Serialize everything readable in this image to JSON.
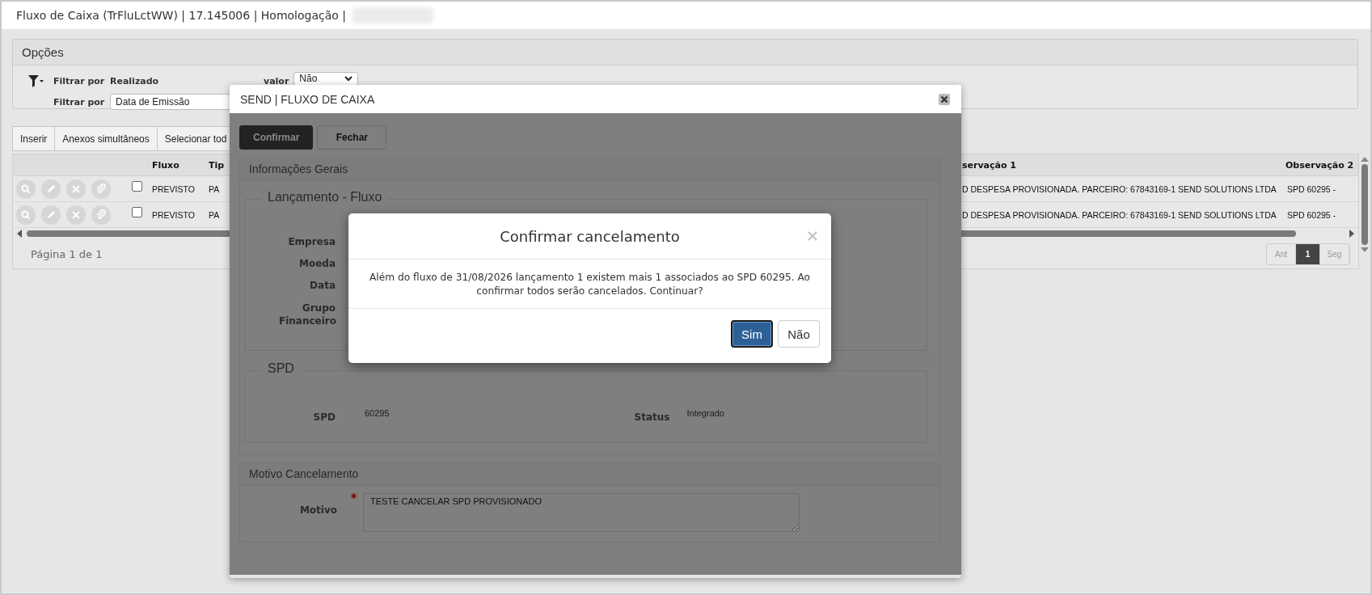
{
  "window": {
    "title": "Fluxo de Caixa (TrFluLctWW) | 17.145006 | Homologação |"
  },
  "options": {
    "title": "Opções",
    "filters": [
      {
        "label": "Filtrar por",
        "value": "Realizado",
        "value_label": "valor",
        "select": "Não"
      },
      {
        "label": "Filtrar por",
        "select": "Data de Emissão"
      }
    ]
  },
  "toolbar": [
    "Inserir",
    "Anexos simultâneos",
    "Selecionar tod"
  ],
  "table": {
    "columns": [
      "Fluxo",
      "Tip",
      "servação 1",
      "Observação 2"
    ],
    "rows": [
      {
        "checked": false,
        "fluxo": "PREVISTO",
        "tipo": "PA",
        "obs1": "D DESPESA PROVISIONADA. PARCEIRO: 67843169-1 SEND SOLUTIONS LTDA",
        "obs2": "SPD 60295 -"
      },
      {
        "checked": false,
        "fluxo": "PREVISTO",
        "tipo": "PA",
        "obs1": "D DESPESA PROVISIONADA. PARCEIRO: 67843169-1 SEND SOLUTIONS LTDA",
        "obs2": "SPD 60295 -"
      }
    ]
  },
  "pagination": {
    "summary": "Página 1 de 1",
    "pages": [
      {
        "label": "Ant",
        "selected": false
      },
      {
        "label": "1",
        "selected": true
      },
      {
        "label": "Seg",
        "selected": false
      }
    ]
  },
  "dialog": {
    "title": "SEND | FLUXO DE CAIXA",
    "buttons": [
      {
        "label": "Confirmar",
        "kind": "primary"
      },
      {
        "label": "Fechar",
        "kind": "default"
      }
    ],
    "general": {
      "title": "Informações Gerais",
      "launch": {
        "legend": "Lançamento - Fluxo",
        "labels": [
          "Empresa",
          "Moeda",
          "Data",
          "Grupo Financeiro"
        ]
      },
      "spd": {
        "legend": "SPD",
        "fields": [
          {
            "label": "SPD",
            "value": "60295"
          },
          {
            "label": "Status",
            "value": "Integrado"
          }
        ]
      }
    },
    "reason": {
      "title": "Motivo Cancelamento",
      "label": "Motivo",
      "required": true,
      "value": "TESTE CANCELAR SPD PROVISIONADO"
    }
  },
  "confirm": {
    "title": "Confirmar cancelamento",
    "message": "Além do fluxo de 31/08/2026 lançamento 1 existem mais 1 associados ao SPD 60295. Ao confirmar todos serão cancelados. Continuar?",
    "buttons": [
      {
        "label": "Sim",
        "selected": true
      },
      {
        "label": "Não",
        "selected": false
      }
    ]
  }
}
